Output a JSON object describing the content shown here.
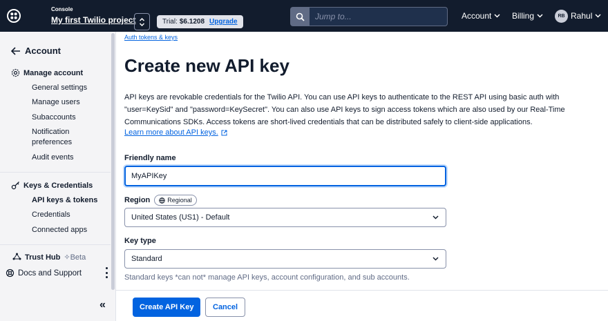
{
  "header": {
    "console_label": "Console",
    "project_name": "My first Twilio project",
    "trial_label": "Trial:",
    "trial_amount": "$6.1208",
    "upgrade_label": "Upgrade",
    "search_placeholder": "Jump to...",
    "account_label": "Account",
    "billing_label": "Billing",
    "user_initials": "RB",
    "user_name": "Rahul"
  },
  "sidebar": {
    "back_label": "Account",
    "manage_account": {
      "title": "Manage account",
      "items": [
        "General settings",
        "Manage users",
        "Subaccounts",
        "Notification preferences",
        "Audit events"
      ]
    },
    "keys_credentials": {
      "title": "Keys & Credentials",
      "items": [
        "API keys & tokens",
        "Credentials",
        "Connected apps"
      ]
    },
    "trust_hub": "Trust Hub",
    "beta": "Beta",
    "docs_support": "Docs and Support"
  },
  "main": {
    "breadcrumb": "Auth tokens & keys",
    "title": "Create new API key",
    "description": "API keys are revokable credentials for the Twilio API. You can use API keys to authenticate to the REST API using basic auth with \"user=KeySid\" and \"password=KeySecret\". You can also use API keys to sign access tokens which are also used by our Real-Time Communications SDKs. Access tokens are short-lived credentials that can be distributed safely to client-side applications.",
    "learn_more": "Learn more about API keys.",
    "friendly_name_label": "Friendly name",
    "friendly_name_value": "MyAPIKey",
    "region_label": "Region",
    "region_badge": "Regional",
    "region_value": "United States (US1) - Default",
    "key_type_label": "Key type",
    "key_type_value": "Standard",
    "key_type_help": "Standard keys *can not* manage API keys, account configuration, and sub accounts.",
    "create_button": "Create API Key",
    "cancel_button": "Cancel"
  },
  "colors": {
    "nav_bg": "#121c2d",
    "primary": "#0263e0",
    "sidebar_bg": "#f4f4f6"
  }
}
